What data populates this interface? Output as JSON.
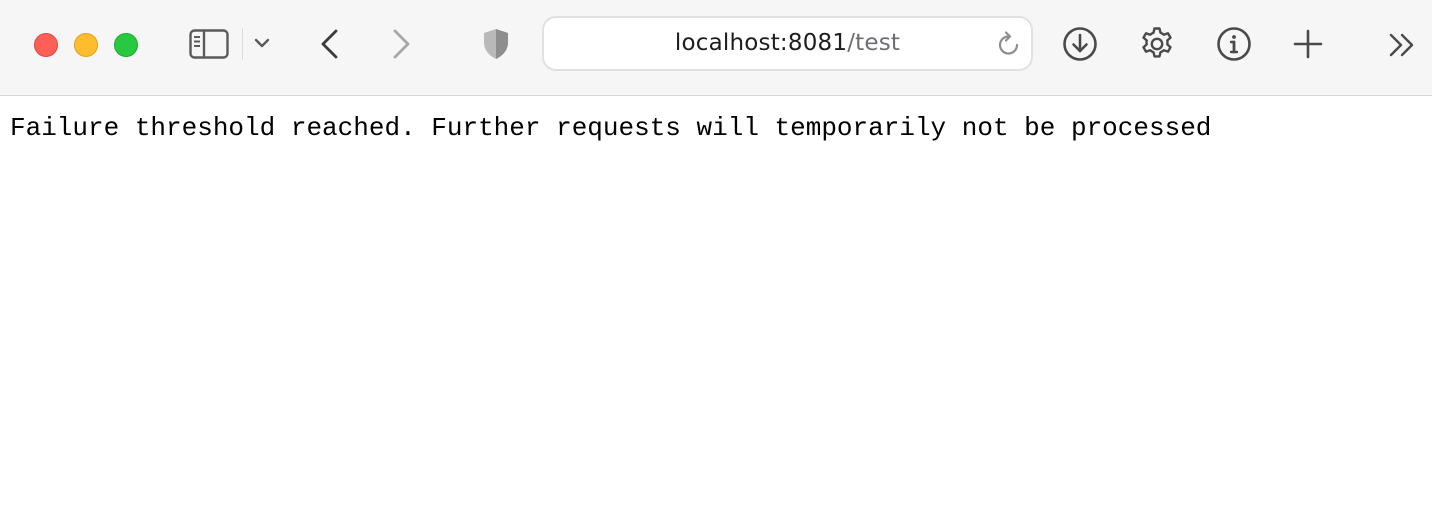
{
  "address_bar": {
    "host": "localhost:8081",
    "path": "/test"
  },
  "toolbar_icons": {
    "sidebar": "sidebar-icon",
    "sidebar_menu": "chevron-down-icon",
    "back": "chevron-left-icon",
    "forward": "chevron-right-icon",
    "privacy": "shield-icon",
    "reload": "reload-icon",
    "downloads": "download-icon",
    "settings": "gear-icon",
    "info": "info-icon",
    "new_tab": "plus-icon",
    "overflow": "double-chevron-right-icon"
  },
  "colors": {
    "close": "#fe5f57",
    "minimize": "#febc2e",
    "zoom": "#28c840"
  },
  "page": {
    "message": "Failure threshold reached. Further requests will temporarily not be processed"
  }
}
